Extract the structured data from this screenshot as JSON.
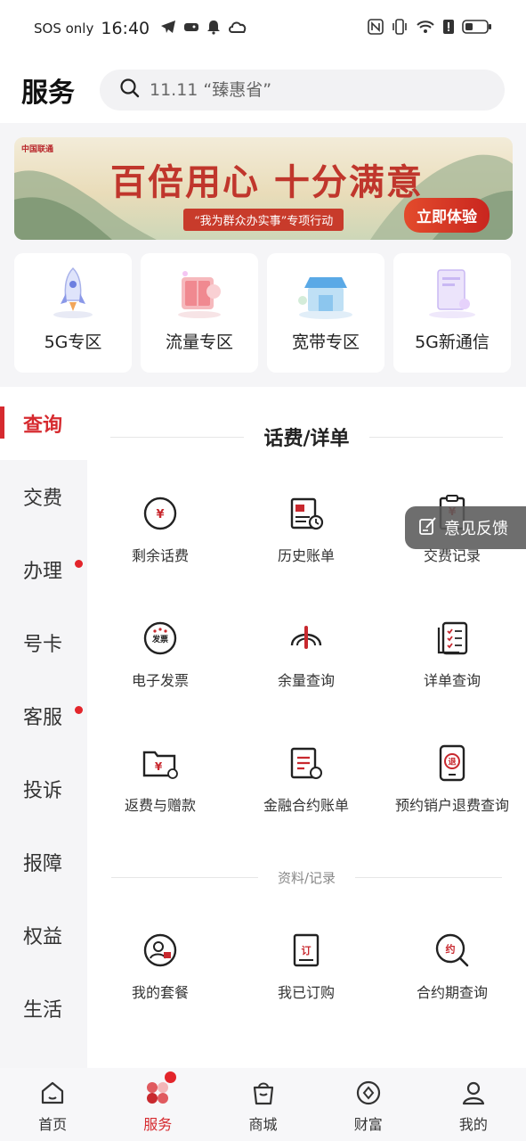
{
  "status": {
    "carrier": "SOS only",
    "time": "16:40"
  },
  "header": {
    "title": "服务",
    "search_placeholder": "11.11 “臻惠省”"
  },
  "banner": {
    "logo_text": "中国联通",
    "slogan": "百倍用心 十分满意",
    "subtitle": "“我为群众办实事”专项行动",
    "cta": "立即体验"
  },
  "quick_cards": [
    {
      "label": "5G专区",
      "icon": "rocket-icon"
    },
    {
      "label": "流量专区",
      "icon": "data-box-icon"
    },
    {
      "label": "宽带专区",
      "icon": "broadband-store-icon"
    },
    {
      "label": "5G新通信",
      "icon": "phone-message-icon"
    }
  ],
  "sidebar": {
    "items": [
      {
        "label": "查询",
        "active": true,
        "dot": false
      },
      {
        "label": "交费",
        "active": false,
        "dot": false
      },
      {
        "label": "办理",
        "active": false,
        "dot": true
      },
      {
        "label": "号卡",
        "active": false,
        "dot": false
      },
      {
        "label": "客服",
        "active": false,
        "dot": true
      },
      {
        "label": "投诉",
        "active": false,
        "dot": false
      },
      {
        "label": "报障",
        "active": false,
        "dot": false
      },
      {
        "label": "权益",
        "active": false,
        "dot": false
      },
      {
        "label": "生活",
        "active": false,
        "dot": false
      }
    ]
  },
  "section_bill": {
    "title": "话费/详单",
    "items": [
      {
        "label": "剩余话费",
        "icon": "yuan-circle-icon"
      },
      {
        "label": "历史账单",
        "icon": "bill-history-icon"
      },
      {
        "label": "交费记录",
        "icon": "payment-record-icon"
      },
      {
        "label": "电子发票",
        "icon": "invoice-icon"
      },
      {
        "label": "余量查询",
        "icon": "gauge-icon"
      },
      {
        "label": "详单查询",
        "icon": "checklist-icon"
      },
      {
        "label": "返费与赠款",
        "icon": "wallet-icon"
      },
      {
        "label": "金融合约账单",
        "icon": "contract-bill-icon"
      },
      {
        "label": "预约销户退费查询",
        "icon": "refund-phone-icon"
      }
    ]
  },
  "section_records": {
    "title": "资料/记录",
    "items": [
      {
        "label": "我的套餐",
        "icon": "user-package-icon"
      },
      {
        "label": "我已订购",
        "icon": "ordered-icon"
      },
      {
        "label": "合约期查询",
        "icon": "contract-search-icon"
      }
    ]
  },
  "feedback": {
    "label": "意见反馈"
  },
  "bottom_nav": [
    {
      "label": "首页",
      "icon": "home-icon",
      "active": false
    },
    {
      "label": "服务",
      "icon": "service-icon",
      "active": true
    },
    {
      "label": "商城",
      "icon": "shop-bag-icon",
      "active": false
    },
    {
      "label": "财富",
      "icon": "wealth-icon",
      "active": false
    },
    {
      "label": "我的",
      "icon": "profile-icon",
      "active": false
    }
  ],
  "colors": {
    "accent": "#d62a2f",
    "icon_red": "#c8282e",
    "sidebar_bg": "#f5f5f7"
  }
}
